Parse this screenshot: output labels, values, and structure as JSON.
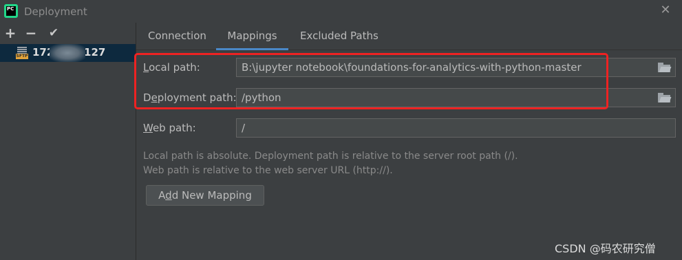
{
  "window": {
    "title": "Deployment",
    "app_icon_text": "PC"
  },
  "toolbar": {
    "add": "+",
    "remove": "−",
    "apply": "✔"
  },
  "servers": [
    {
      "label_start": "172",
      "label_end": ".127",
      "protocol": "SFTP"
    }
  ],
  "tabs": [
    "Connection",
    "Mappings",
    "Excluded Paths"
  ],
  "active_tab": "Mappings",
  "form": {
    "local_path": {
      "label_mnemonic": "L",
      "label_rest": "ocal path:",
      "value": "B:\\jupyter notebook\\foundations-for-analytics-with-python-master"
    },
    "deployment_path": {
      "label_start": "D",
      "label_mnemonic": "e",
      "label_rest": "ployment path:",
      "value": "/python"
    },
    "web_path": {
      "label_mnemonic": "W",
      "label_rest": "eb path:",
      "value": "/"
    }
  },
  "hints": [
    "Local path is absolute. Deployment path is relative to the server root path (/).",
    "Web path is relative to the web server URL (http://)."
  ],
  "buttons": {
    "add_mapping_start": "A",
    "add_mapping_mnemonic": "d",
    "add_mapping_rest": "d New Mapping"
  },
  "watermark": "CSDN @码农研究僧",
  "colors": {
    "highlight_box": "#ee2222",
    "tab_underline": "#4a88c7",
    "selection": "#0d293e"
  }
}
